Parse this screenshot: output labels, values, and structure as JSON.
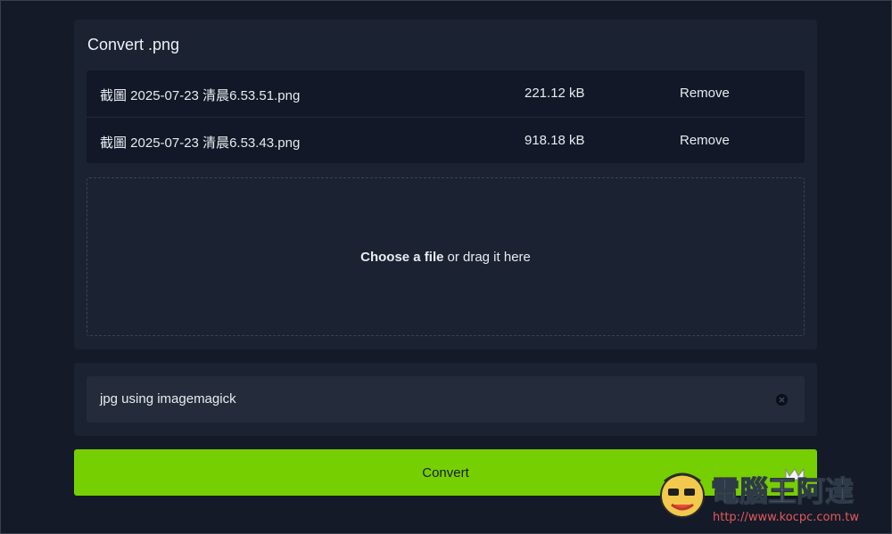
{
  "upload_panel": {
    "title": "Convert .png",
    "files": [
      {
        "name": "截圖 2025-07-23 清晨6.53.51.png",
        "size": "221.12 kB",
        "remove_label": "Remove"
      },
      {
        "name": "截圖 2025-07-23 清晨6.53.43.png",
        "size": "918.18 kB",
        "remove_label": "Remove"
      }
    ],
    "dropzone": {
      "choose_label": "Choose a file",
      "drag_label": "or drag it here"
    }
  },
  "convert_panel": {
    "selected_format": "jpg using imagemagick",
    "clear_icon": "clear-circle-icon"
  },
  "convert_button": {
    "label": "Convert"
  },
  "watermark": {
    "brand": "電腦王阿達",
    "url": "http://www.kocpc.com.tw"
  },
  "colors": {
    "background": "#141a28",
    "panel": "#1b2232",
    "file_list": "#121827",
    "select": "#242c3c",
    "accent": "#76cf00"
  }
}
